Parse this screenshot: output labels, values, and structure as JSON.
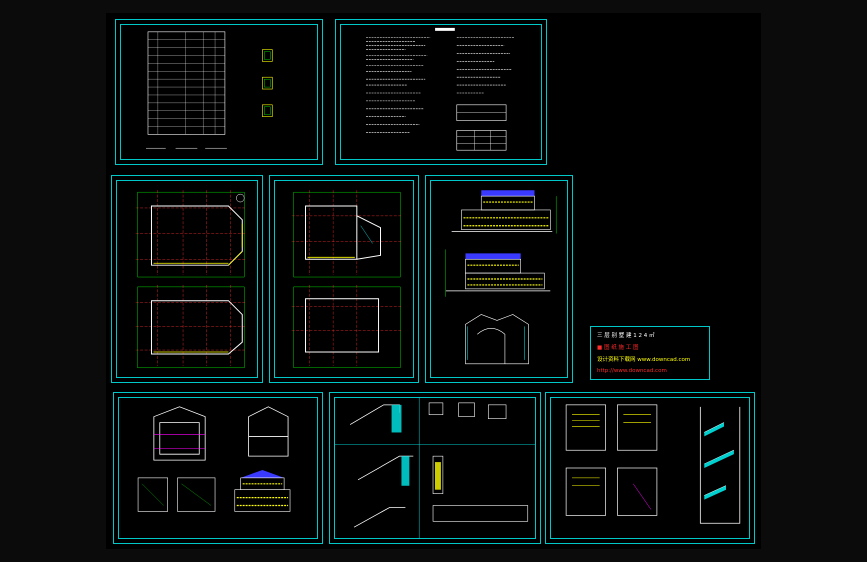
{
  "drawing": {
    "background": "#000000",
    "outer_background": "#0b0b0b",
    "frame_color": "#00c8c8",
    "sheets": [
      {
        "id": "sheet-index",
        "kind": "drawing-list"
      },
      {
        "id": "sheet-notes",
        "kind": "design-notes"
      },
      {
        "id": "sheet-plan-1",
        "kind": "floor-plans"
      },
      {
        "id": "sheet-plan-2",
        "kind": "floor-plans"
      },
      {
        "id": "sheet-elevations",
        "kind": "elevations"
      },
      {
        "id": "sheet-sections",
        "kind": "sections"
      },
      {
        "id": "sheet-details",
        "kind": "details"
      },
      {
        "id": "sheet-stairs",
        "kind": "stair-details"
      }
    ]
  },
  "legend": {
    "border_color": "#00c8c8",
    "lines": [
      {
        "text": "三 层 别 墅   建 1 2 4 ㎡",
        "color": "#ffffff"
      },
      {
        "text": "■ 图 纸      施 工 图",
        "color": "#ff2a2a"
      },
      {
        "text": "设计资料下载网 www.downcad.com",
        "color": "#ffff00"
      },
      {
        "text": "http://www.downcad.com",
        "color": "#ff2a2a"
      }
    ]
  },
  "colors": {
    "wall": "#ffffff",
    "axis": "#ff3030",
    "dim": "#00ff00",
    "window": "#ffff00",
    "roof": "#3a3aff",
    "stair": "#00d0d0",
    "hatch": "#ff00ff"
  }
}
